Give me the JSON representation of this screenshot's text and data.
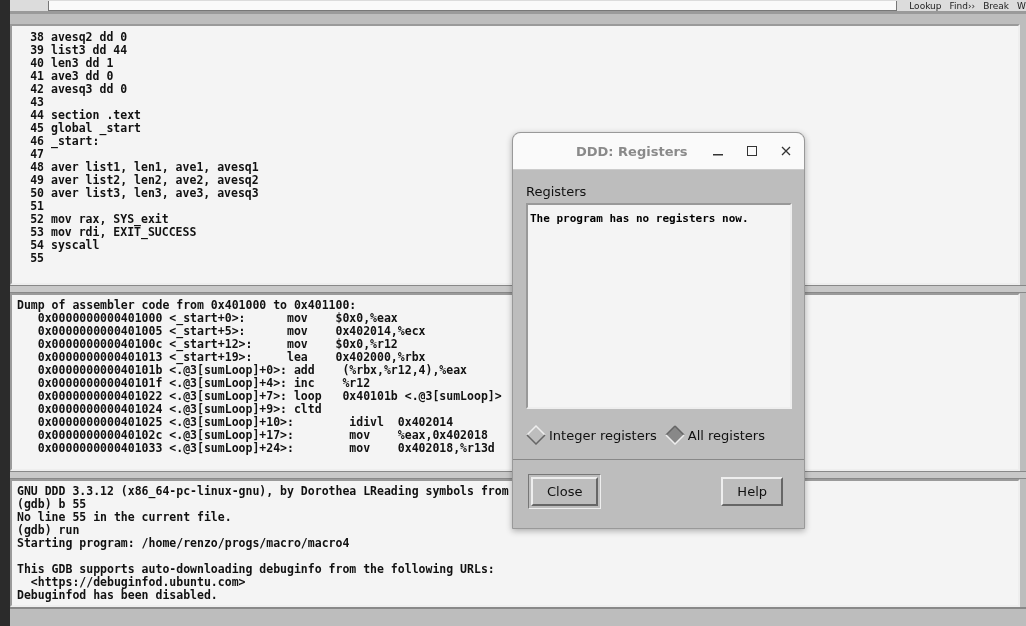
{
  "toolbar": {
    "buttons": [
      {
        "label": "Lookup"
      },
      {
        "label": "Find››"
      },
      {
        "label": "Break"
      },
      {
        "label": "W"
      }
    ]
  },
  "source": {
    "lines": [
      {
        "number": "38",
        "code": "avesq2 dd 0"
      },
      {
        "number": "39",
        "code": "list3 dd 44"
      },
      {
        "number": "40",
        "code": "len3 dd 1"
      },
      {
        "number": "41",
        "code": "ave3 dd 0"
      },
      {
        "number": "42",
        "code": "avesq3 dd 0"
      },
      {
        "number": "43"
      },
      {
        "number": "44",
        "code": "section .text"
      },
      {
        "number": "45",
        "code": "global _start"
      },
      {
        "number": "46",
        "code": "_start:"
      },
      {
        "number": "47"
      },
      {
        "number": "48",
        "code": "aver list1, len1, ave1, avesq1"
      },
      {
        "number": "49",
        "code": "aver list2, len2, ave2, avesq2"
      },
      {
        "number": "50",
        "code": "aver list3, len3, ave3, avesq3"
      },
      {
        "number": "51"
      },
      {
        "number": "52",
        "code": "mov rax, SYS_exit"
      },
      {
        "number": "53",
        "code": "mov rdi, EXIT_SUCCESS"
      },
      {
        "number": "54",
        "code": "syscall"
      },
      {
        "number": "55"
      }
    ]
  },
  "assembler": {
    "lines": [
      "Dump of assembler code from 0x401000 to 0x401100:",
      "   0x0000000000401000 <_start+0>:      mov    $0x0,%eax",
      "   0x0000000000401005 <_start+5>:      mov    0x402014,%ecx",
      "   0x000000000040100c <_start+12>:     mov    $0x0,%r12",
      "   0x0000000000401013 <_start+19>:     lea    0x402000,%rbx",
      "   0x000000000040101b <.@3[sumLoop]+0>: add    (%rbx,%r12,4),%eax",
      "   0x000000000040101f <.@3[sumLoop]+4>: inc    %r12",
      "   0x0000000000401022 <.@3[sumLoop]+7>: loop   0x40101b <.@3[sumLoop]>",
      "   0x0000000000401024 <.@3[sumLoop]+9>: cltd",
      "   0x0000000000401025 <.@3[sumLoop]+10>:        idivl  0x402014",
      "   0x000000000040102c <.@3[sumLoop]+17>:        mov    %eax,0x402018",
      "   0x0000000000401033 <.@3[sumLoop]+24>:        mov    0x402018,%r13d"
    ]
  },
  "console": {
    "blocks": [
      [
        "GNU DDD 3.3.12 (x86_64-pc-linux-gnu), by Dorothea LReading symbols from",
        "(gdb) b 55",
        "No line 55 in the current file.",
        "(gdb) run",
        "Starting program: /home/renzo/progs/macro/macro4"
      ],
      [
        "This GDB supports auto-downloading debuginfo from the following URLs:",
        "  <https://debuginfod.ubuntu.com>",
        "Debuginfod has been disabled."
      ]
    ]
  },
  "dialog": {
    "title": "DDD: Registers",
    "label": "Registers",
    "content": "The program has no registers now.",
    "options": [
      {
        "label": "Integer registers",
        "selected": false
      },
      {
        "label": "All registers",
        "selected": true
      }
    ],
    "buttons": [
      {
        "label": "Close",
        "default": true
      },
      {
        "label": "Help",
        "default": false
      }
    ]
  }
}
